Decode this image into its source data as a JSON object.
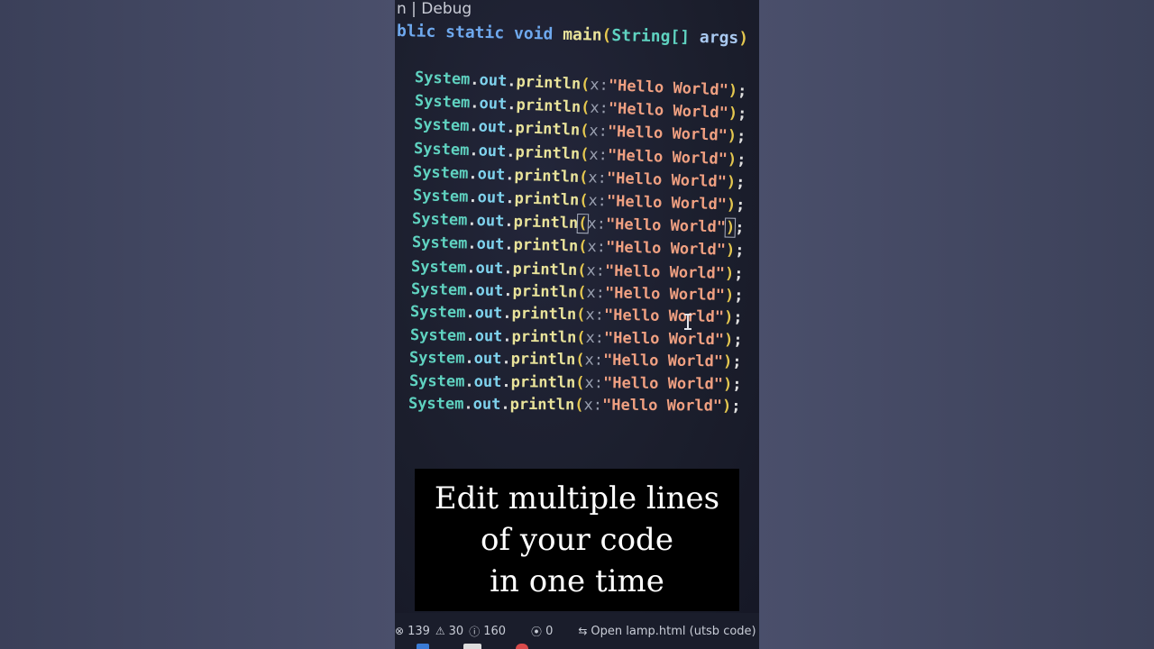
{
  "editor": {
    "codelens": "n | Debug",
    "signature": {
      "keywords": "blic static void",
      "method": "main",
      "open_paren": "(",
      "param_type": "String[]",
      "param_name": "args",
      "close_paren": ")"
    },
    "line_template": {
      "class_name": "System",
      "dot": ".",
      "field": "out",
      "method": "println",
      "open_paren": "(",
      "param_hint": "x:",
      "string": "\"Hello World\"",
      "close_paren": ")",
      "semicolon": ";"
    },
    "line_count": 15
  },
  "caption": {
    "line1": "Edit multiple lines",
    "line2": "of your code",
    "line3": "in one time"
  },
  "statusbar": {
    "errors": "139",
    "warnings": "30",
    "info": "160",
    "ports": "0",
    "open_file": "Open lamp.html (utsb code)"
  },
  "colors": {
    "editor_bg": "#1b1e2c",
    "class": "#5fd2c0",
    "method": "#e9e39a",
    "string": "#f0a081",
    "keyword": "#6fa9ee",
    "caption_bg": "#000000"
  }
}
